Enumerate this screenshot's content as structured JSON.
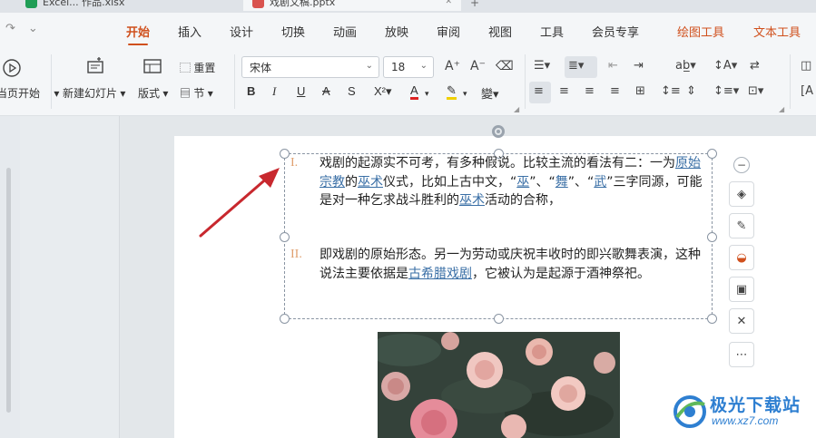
{
  "tabs": [
    {
      "label": "Excel... 作品.xlsx"
    },
    {
      "label": "戏剧文稿.pptx"
    }
  ],
  "menu": {
    "items": [
      "开始",
      "插入",
      "设计",
      "切换",
      "动画",
      "放映",
      "审阅",
      "视图",
      "工具",
      "会员专享"
    ],
    "active": "开始",
    "context_tabs": [
      "绘图工具",
      "文本工具"
    ],
    "accent_color": "#d0501d"
  },
  "ribbon": {
    "play_label": "从当页开始",
    "new_slide": "新建幻灯片",
    "layout": "版式",
    "reset": "重置",
    "section": "节",
    "font_name": "宋体",
    "font_size": "18"
  },
  "slide": {
    "items": [
      {
        "numeral": "I.",
        "segments": [
          {
            "text": "戏剧的起源实不可考，有多种假说。比较主流的看法有二：一为",
            "link": false
          },
          {
            "text": "原始宗教",
            "link": true
          },
          {
            "text": "的",
            "link": false
          },
          {
            "text": "巫术",
            "link": true
          },
          {
            "text": "仪式，比如上古中文，“",
            "link": false
          },
          {
            "text": "巫",
            "link": true
          },
          {
            "text": "”、“",
            "link": false
          },
          {
            "text": "舞",
            "link": true
          },
          {
            "text": "”、“",
            "link": false
          },
          {
            "text": "武",
            "link": true
          },
          {
            "text": "”三字同源，可能是对一种乞求战斗胜利的",
            "link": false
          },
          {
            "text": "巫术",
            "link": true
          },
          {
            "text": "活动的合称，",
            "link": false
          }
        ]
      },
      {
        "numeral": "II.",
        "segments": [
          {
            "text": "即戏剧的原始形态。另一为劳动或庆祝丰收时的即兴歌舞表演，这种说法主要依据是",
            "link": false
          },
          {
            "text": "古希腊戏剧",
            "link": true
          },
          {
            "text": "，它被认为是起源于酒神祭祀。",
            "link": false
          }
        ]
      }
    ]
  },
  "watermark": {
    "title": "极光下载站",
    "url": "www.xz7.com"
  }
}
